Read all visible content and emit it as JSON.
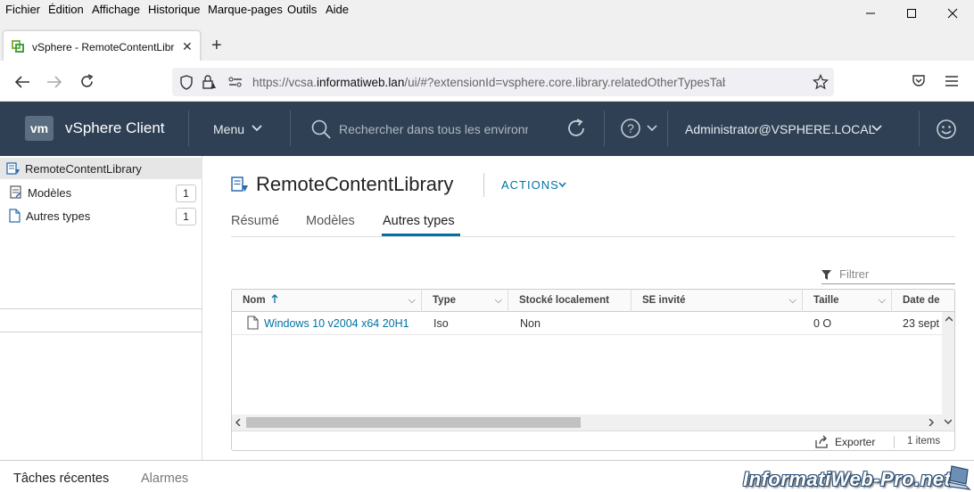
{
  "browser": {
    "menu": [
      "Fichier",
      "Édition",
      "Affichage",
      "Historique",
      "Marque-pages",
      "Outils",
      "Aide"
    ],
    "tab_title": "vSphere - RemoteContentLibrar",
    "url_prefix": "https://vcsa.",
    "url_domain": "informatiweb.lan",
    "url_rest": "/ui/#?extensionId=vsphere.core.library.relatedOtherTypesTab&objectId=u"
  },
  "header": {
    "logo": "vm",
    "app_title": "vSphere Client",
    "menu_label": "Menu",
    "search_placeholder": "Rechercher dans tous les environn",
    "user": "Administrator@VSPHERE.LOCAL"
  },
  "sidebar": {
    "root": "RemoteContentLibrary",
    "items": [
      {
        "label": "Modèles",
        "count": "1"
      },
      {
        "label": "Autres types",
        "count": "1"
      }
    ]
  },
  "main": {
    "title": "RemoteContentLibrary",
    "actions_label": "ACTIONS",
    "tabs": [
      "Résumé",
      "Modèles",
      "Autres types"
    ],
    "active_tab": "Autres types",
    "filter_placeholder": "Filtrer",
    "columns": [
      "Nom",
      "Type",
      "Stocké localement",
      "SE invité",
      "Taille",
      "Date de"
    ],
    "rows": [
      {
        "name": "Windows 10 v2004 x64 20H1",
        "type": "Iso",
        "stored": "Non",
        "guest_os": "",
        "size": "0 O",
        "date": "23 sept"
      }
    ],
    "export_label": "Exporter",
    "items_count": "1 items"
  },
  "bottom": {
    "recent_tasks": "Tâches récentes",
    "alarms": "Alarmes",
    "watermark": "InformatiWeb-Pro.net"
  },
  "colors": {
    "header_bg": "#2f4054",
    "accent": "#0072a3"
  }
}
